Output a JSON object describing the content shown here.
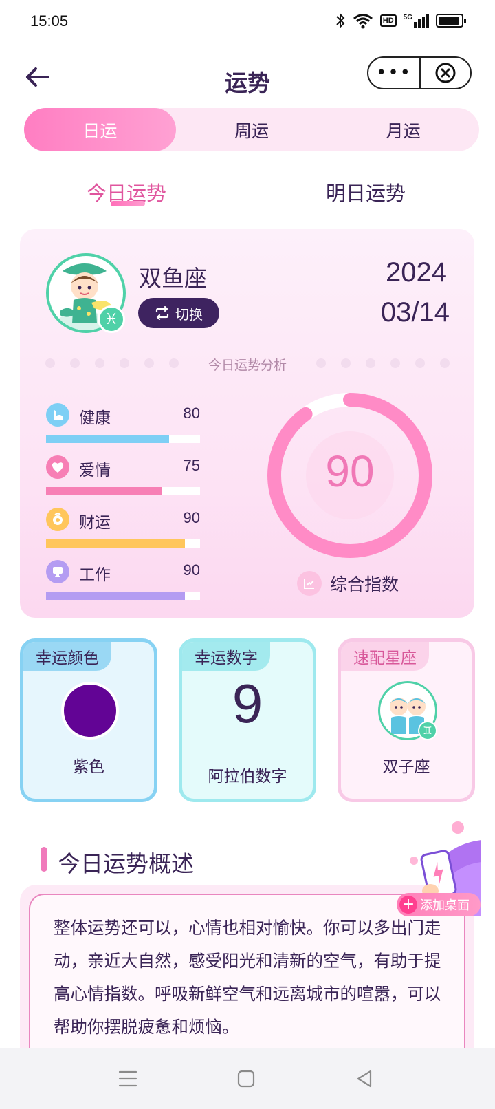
{
  "status_bar": {
    "time": "15:05",
    "hd_label": "HD",
    "network_label": "5G"
  },
  "header": {
    "title": "运势",
    "more_label": "•••"
  },
  "period_tabs": [
    {
      "label": "日运",
      "active": true
    },
    {
      "label": "周运",
      "active": false
    },
    {
      "label": "月运",
      "active": false
    }
  ],
  "day_tabs": [
    {
      "label": "今日运势",
      "active": true
    },
    {
      "label": "明日运势",
      "active": false
    }
  ],
  "profile": {
    "sign_name": "双鱼座",
    "sign_symbol": "♓",
    "switch_label": "切换",
    "year": "2024",
    "month_day": "03/14"
  },
  "analysis": {
    "title": "今日运势分析",
    "metrics": [
      {
        "label": "健康",
        "value": 80,
        "color": "#7ecff5",
        "icon": "muscle-icon"
      },
      {
        "label": "爱情",
        "value": 75,
        "color": "#f77fb5",
        "icon": "heart-icon"
      },
      {
        "label": "财运",
        "value": 90,
        "color": "#ffc65c",
        "icon": "coin-icon"
      },
      {
        "label": "工作",
        "value": 90,
        "color": "#b49cf2",
        "icon": "monitor-icon"
      }
    ],
    "overall_score": 90,
    "overall_label": "综合指数",
    "ring_color": "#ff8bc6"
  },
  "lucky": {
    "color": {
      "tag": "幸运颜色",
      "value": "紫色",
      "swatch": "#620495"
    },
    "number": {
      "tag": "幸运数字",
      "digit": "9",
      "value": "阿拉伯数字"
    },
    "match": {
      "tag": "速配星座",
      "value": "双子座",
      "symbol": "♊"
    }
  },
  "overview": {
    "title": "今日运势概述",
    "text": "整体运势还可以，心情也相对愉快。你可以多出门走动，亲近大自然，感受阳光和清新的空气，有助于提高心情指数。呼吸新鲜空气和远离城市的喧嚣，可以帮助你摆脱疲惫和烦恼。"
  },
  "add_desktop": {
    "plus": "+",
    "label": "添加桌面"
  }
}
